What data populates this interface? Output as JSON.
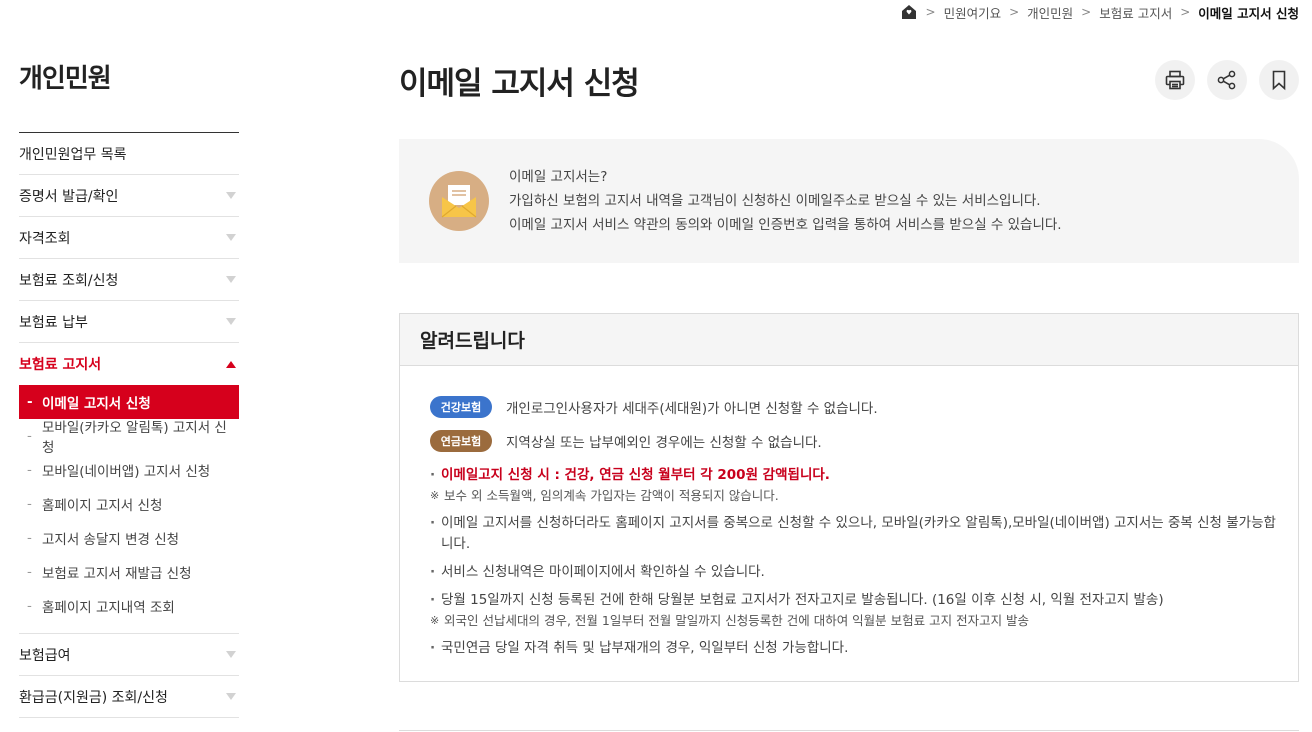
{
  "breadcrumb": {
    "items": [
      "민원여기요",
      "개인민원",
      "보험료 고지서",
      "이메일 고지서 신청"
    ]
  },
  "sidebar": {
    "title": "개인민원",
    "items": [
      {
        "label": "개인민원업무 목록"
      },
      {
        "label": "증명서 발급/확인"
      },
      {
        "label": "자격조회"
      },
      {
        "label": "보험료 조회/신청"
      },
      {
        "label": "보험료 납부"
      },
      {
        "label": "보험료 고지서"
      },
      {
        "label": "보험급여"
      },
      {
        "label": "환급금(지원금) 조회/신청"
      }
    ],
    "sub_items": [
      {
        "label": "이메일 고지서 신청"
      },
      {
        "label": "모바일(카카오 알림톡) 고지서 신청"
      },
      {
        "label": "모바일(네이버앱) 고지서 신청"
      },
      {
        "label": "홈페이지 고지서 신청"
      },
      {
        "label": "고지서 송달지 변경 신청"
      },
      {
        "label": "보험료 고지서 재발급 신청"
      },
      {
        "label": "홈페이지 고지내역 조회"
      }
    ]
  },
  "main": {
    "title": "이메일 고지서 신청",
    "info": {
      "line1": "이메일 고지서는?",
      "line2": "가입하신 보험의 고지서 내역을 고객님이 신청하신 이메일주소로 받으실 수 있는 서비스입니다.",
      "line3": "이메일 고지서 서비스 약관의 동의와 이메일 인증번호 입력을 통하여 서비스를 받으실 수 있습니다."
    },
    "notice": {
      "heading": "알려드립니다",
      "badges": [
        {
          "label": "건강보험",
          "text": "개인로그인사용자가 세대주(세대원)가 아니면 신청할 수 없습니다."
        },
        {
          "label": "연금보험",
          "text": "지역상실 또는 납부예외인 경우에는 신청할 수 없습니다."
        }
      ],
      "bullet1": "이메일고지 신청 시 : 건강, 연금 신청 월부터 각 200원 감액됩니다.",
      "bullet1_note": "보수 외 소득월액, 임의계속 가입자는 감액이 적용되지 않습니다.",
      "bullet2": "이메일 고지서를 신청하더라도 홈페이지 고지서를 중복으로 신청할 수 있으나, 모바일(카카오 알림톡),모바일(네이버앱) 고지서는 중복 신청 불가능합니다.",
      "bullet3": "서비스 신청내역은 마이페이지에서 확인하실 수 있습니다.",
      "bullet4": "당월 15일까지 신청 등록된 건에 한해 당월분 보험료 고지서가 전자고지로 발송됩니다. (16일 이후 신청 시, 익월 전자고지 발송)",
      "bullet4_note": "외국인 선납세대의 경우, 전월 1일부터 전월 말일까지 신청등록한 건에 대하여 익월분 보험료 고지 전자고지 발송",
      "bullet5": "국민연금 당일 자격 취득 및 납부재개의 경우, 익일부터 신청 가능합니다."
    }
  },
  "colors": {
    "accent": "#d6001c",
    "badge_health": "#3b74cc",
    "badge_pension": "#9b6b3d",
    "mail_icon_bg": "#d7ae84"
  },
  "icons": [
    "home-icon",
    "print-icon",
    "share-icon",
    "bookmark-icon",
    "mail-icon"
  ]
}
